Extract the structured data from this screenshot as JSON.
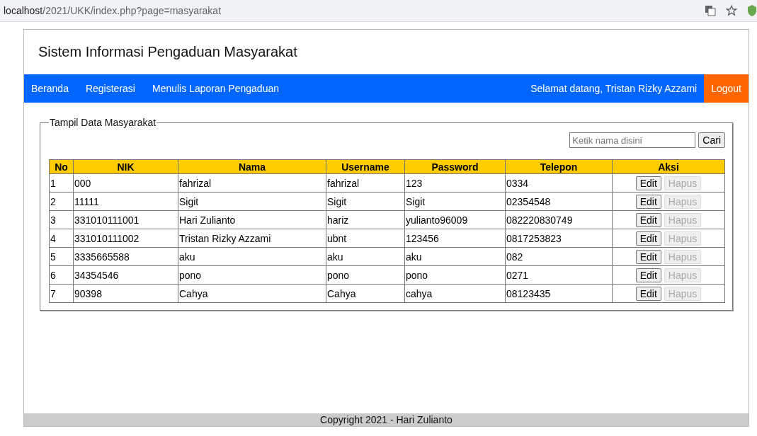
{
  "browser": {
    "url_host": "localhost",
    "url_path": "/2021/UKK/index.php?page=masyarakat"
  },
  "header": {
    "title": "Sistem Informasi Pengaduan Masyarakat"
  },
  "nav": {
    "items": [
      "Beranda",
      "Registerasi",
      "Menulis Laporan Pengaduan"
    ],
    "welcome": "Selamat datang, Tristan Rizky Azzami",
    "logout": "Logout"
  },
  "panel": {
    "legend": "Tampil Data Masyarakat",
    "search": {
      "placeholder": "Ketik nama disini",
      "button": "Cari"
    }
  },
  "table": {
    "columns": [
      "No",
      "NIK",
      "Nama",
      "Username",
      "Password",
      "Telepon",
      "Aksi"
    ],
    "rows": [
      {
        "cells": [
          "1",
          "000",
          "fahrizal",
          "fahrizal",
          "123",
          "0334"
        ],
        "actions": [
          {
            "label": "Edit",
            "disabled": false
          },
          {
            "label": "Hapus",
            "disabled": true
          }
        ]
      },
      {
        "cells": [
          "2",
          "11111",
          "Sigit",
          "Sigit",
          "Sigit",
          "02354548"
        ],
        "actions": [
          {
            "label": "Edit",
            "disabled": false
          },
          {
            "label": "Hapus",
            "disabled": true
          }
        ]
      },
      {
        "cells": [
          "3",
          "331010111001",
          "Hari Zulianto",
          "hariz",
          "yulianto96009",
          "082220830749"
        ],
        "actions": [
          {
            "label": "Edit",
            "disabled": false
          },
          {
            "label": "Hapus",
            "disabled": true
          }
        ]
      },
      {
        "cells": [
          "4",
          "331010111002",
          "Tristan Rizky Azzami",
          "ubnt",
          "123456",
          "0817253823"
        ],
        "actions": [
          {
            "label": "Edit",
            "disabled": false
          },
          {
            "label": "Hapus",
            "disabled": true
          }
        ]
      },
      {
        "cells": [
          "5",
          "3335665588",
          "aku",
          "aku",
          "aku",
          "082"
        ],
        "actions": [
          {
            "label": "Edit",
            "disabled": false
          },
          {
            "label": "Hapus",
            "disabled": true
          }
        ]
      },
      {
        "cells": [
          "6",
          "34354546",
          "pono",
          "pono",
          "pono",
          "0271"
        ],
        "actions": [
          {
            "label": "Edit",
            "disabled": false
          },
          {
            "label": "Hapus",
            "disabled": true
          }
        ]
      },
      {
        "cells": [
          "7",
          "90398",
          "Cahya",
          "Cahya",
          "cahya",
          "08123435"
        ],
        "actions": [
          {
            "label": "Edit",
            "disabled": false
          },
          {
            "label": "Hapus",
            "disabled": true
          }
        ]
      }
    ]
  },
  "footer": {
    "text": "Copyright 2021 - Hari Zulianto"
  }
}
